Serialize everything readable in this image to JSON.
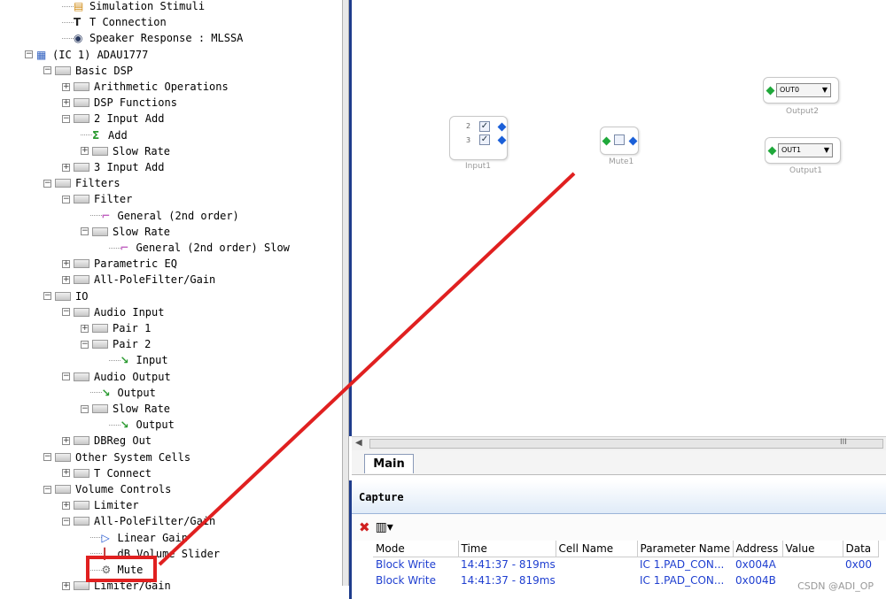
{
  "tree": [
    {
      "label": "Simulation Stimuli",
      "indent": 3,
      "icon": "stimuli-icon",
      "exp": ""
    },
    {
      "label": "T Connection",
      "indent": 3,
      "icon": "t-connection-icon",
      "exp": ""
    },
    {
      "label": "Speaker Response : MLSSA",
      "indent": 3,
      "icon": "speaker-icon",
      "exp": ""
    },
    {
      "label": "(IC 1) ADAU1777",
      "indent": 1,
      "icon": "chip-icon",
      "exp": "−"
    },
    {
      "label": "Basic DSP",
      "indent": 2,
      "icon": "folder",
      "exp": "−"
    },
    {
      "label": "Arithmetic Operations",
      "indent": 3,
      "icon": "folder",
      "exp": "+"
    },
    {
      "label": "DSP Functions",
      "indent": 3,
      "icon": "folder",
      "exp": "+"
    },
    {
      "label": "2 Input Add",
      "indent": 3,
      "icon": "folder",
      "exp": "−"
    },
    {
      "label": "Add",
      "indent": 4,
      "icon": "adder-icon",
      "exp": ""
    },
    {
      "label": "Slow Rate",
      "indent": 4,
      "icon": "folder",
      "exp": "+"
    },
    {
      "label": "3 Input Add",
      "indent": 3,
      "icon": "folder",
      "exp": "+"
    },
    {
      "label": "Filters",
      "indent": 2,
      "icon": "folder",
      "exp": "−"
    },
    {
      "label": "Filter",
      "indent": 3,
      "icon": "folder",
      "exp": "−"
    },
    {
      "label": "General (2nd order)",
      "indent": 4.5,
      "icon": "filter-curve-icon",
      "exp": ""
    },
    {
      "label": "Slow Rate",
      "indent": 4,
      "icon": "folder",
      "exp": "−"
    },
    {
      "label": "General (2nd order) Slow",
      "indent": 5.5,
      "icon": "filter-curve-icon",
      "exp": ""
    },
    {
      "label": "Parametric EQ",
      "indent": 3,
      "icon": "folder",
      "exp": "+"
    },
    {
      "label": "All-PoleFilter/Gain",
      "indent": 3,
      "icon": "folder",
      "exp": "+"
    },
    {
      "label": "IO",
      "indent": 2,
      "icon": "folder",
      "exp": "−"
    },
    {
      "label": "Audio Input",
      "indent": 3,
      "icon": "folder",
      "exp": "−"
    },
    {
      "label": "Pair 1",
      "indent": 4,
      "icon": "folder",
      "exp": "+"
    },
    {
      "label": "Pair 2",
      "indent": 4,
      "icon": "folder",
      "exp": "−"
    },
    {
      "label": "Input",
      "indent": 5.5,
      "icon": "input-pin-icon",
      "exp": ""
    },
    {
      "label": "Audio Output",
      "indent": 3,
      "icon": "folder",
      "exp": "−"
    },
    {
      "label": "Output",
      "indent": 4.5,
      "icon": "output-pin-icon",
      "exp": ""
    },
    {
      "label": "Slow Rate",
      "indent": 4,
      "icon": "folder",
      "exp": "−"
    },
    {
      "label": "Output",
      "indent": 5.5,
      "icon": "output-pin-icon",
      "exp": ""
    },
    {
      "label": "DBReg Out",
      "indent": 3,
      "icon": "folder",
      "exp": "+"
    },
    {
      "label": "Other System Cells",
      "indent": 2,
      "icon": "folder",
      "exp": "−"
    },
    {
      "label": "T Connect",
      "indent": 3,
      "icon": "folder",
      "exp": "+"
    },
    {
      "label": "Volume Controls",
      "indent": 2,
      "icon": "folder",
      "exp": "−"
    },
    {
      "label": "Limiter",
      "indent": 3,
      "icon": "folder",
      "exp": "+"
    },
    {
      "label": "All-PoleFilter/Gain",
      "indent": 3,
      "icon": "folder",
      "exp": "−"
    },
    {
      "label": "Linear Gain",
      "indent": 4.5,
      "icon": "gain-icon",
      "exp": ""
    },
    {
      "label": "dB Volume Slider",
      "indent": 4.5,
      "icon": "slider-icon",
      "exp": ""
    },
    {
      "label": "Mute",
      "indent": 4.5,
      "icon": "mute-icon",
      "exp": ""
    },
    {
      "label": "Limiter/Gain",
      "indent": 3,
      "icon": "folder",
      "exp": "+"
    }
  ],
  "canvas": {
    "input_block": {
      "label": "Input1",
      "channels": [
        "2",
        "3"
      ]
    },
    "mute_block": {
      "label": "Mute1"
    },
    "output_blocks": [
      {
        "label": "Output2",
        "value": "OUT0"
      },
      {
        "label": "Output1",
        "value": "OUT1"
      }
    ],
    "scroll_marker": "III"
  },
  "tabs": [
    {
      "label": "Main"
    }
  ],
  "capture": {
    "title": "Capture",
    "columns": [
      "Mode",
      "Time",
      "Cell Name",
      "Parameter Name",
      "Address",
      "Value",
      "Data"
    ],
    "rows": [
      [
        "Block Write",
        "14:41:37 - 819ms",
        "",
        "IC 1.PAD_CON...",
        "0x004A",
        "",
        "0x00"
      ],
      [
        "Block Write",
        "14:41:37 - 819ms",
        "",
        "IC 1.PAD_CON...",
        "0x004B",
        "",
        ""
      ]
    ]
  },
  "watermark": "CSDN @ADI_OP",
  "colors": {
    "annotation": "#e02020",
    "link": "#1f3fd0",
    "accent": "#1e3c8c"
  }
}
